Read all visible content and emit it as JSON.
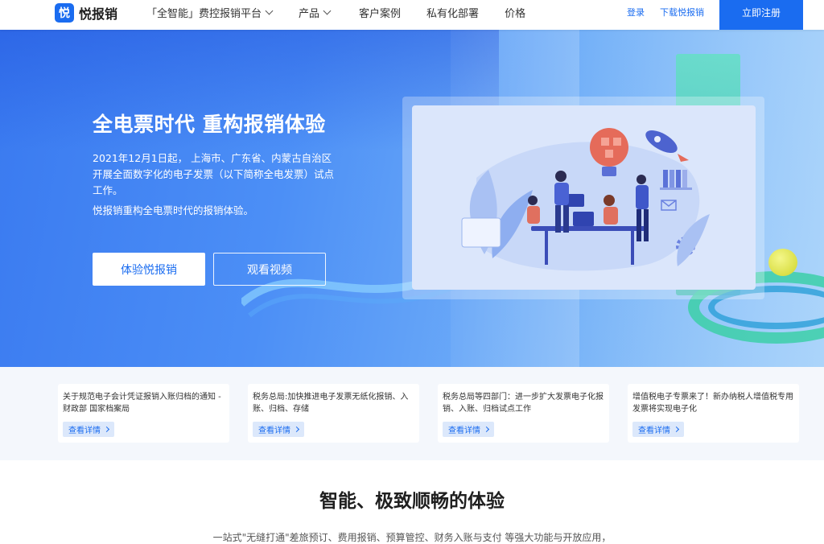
{
  "brand": {
    "logo_char": "悦",
    "name": "悦报销",
    "color": "#1a6cf0"
  },
  "nav": {
    "items": [
      {
        "label": "「全智能」费控报销平台",
        "dropdown": true
      },
      {
        "label": "产品",
        "dropdown": true
      },
      {
        "label": "客户案例",
        "dropdown": false
      },
      {
        "label": "私有化部署",
        "dropdown": false
      },
      {
        "label": "价格",
        "dropdown": false
      }
    ],
    "login": "登录",
    "download": "下载悦报销",
    "register": "立即注册"
  },
  "hero": {
    "title": "全电票时代 重构报销体验",
    "description": "2021年12月1日起， 上海市、广东省、内蒙古自治区开展全面数字化的电子发票（以下简称全电发票）试点工作。",
    "subtitle": "悦报销重构全电票时代的报销体验。",
    "primary_button": "体验悦报销",
    "secondary_button": "观看视频"
  },
  "news": [
    {
      "title": "关于规范电子会计凭证报销入账归档的通知 - 财政部 国家档案局",
      "button": "查看详情"
    },
    {
      "title": "税务总局:加快推进电子发票无纸化报销、入账、归档、存储",
      "button": "查看详情"
    },
    {
      "title": "税务总局等四部门：进一步扩大发票电子化报销、入账、归档试点工作",
      "button": "查看详情"
    },
    {
      "title": "增值税电子专票来了！新办纳税人增值税专用发票将实现电子化",
      "button": "查看详情"
    }
  ],
  "feature": {
    "title": "智能、极致顺畅的体验",
    "subtitle": "一站式\"无缝打通\"差旅预订、费用报销、预算管控、财务入账与支付 等强大功能与开放应用，"
  }
}
